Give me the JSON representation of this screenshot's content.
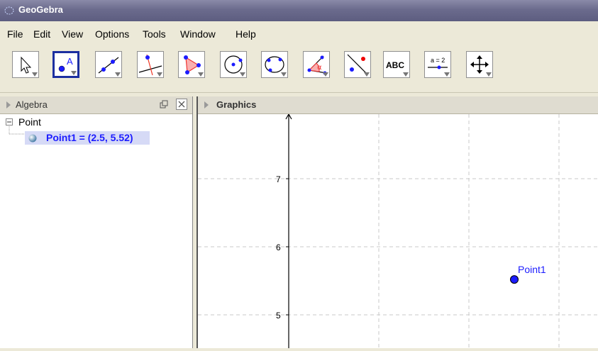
{
  "window": {
    "title": "GeoGebra"
  },
  "menu": [
    "File",
    "Edit",
    "View",
    "Options",
    "Tools",
    "Window",
    "Help"
  ],
  "toolbar": {
    "tools": [
      {
        "icon": "move-arrow-icon"
      },
      {
        "icon": "new-point-icon",
        "label": "A",
        "selected": true
      },
      {
        "icon": "line-through-two-points-icon"
      },
      {
        "icon": "perpendicular-line-icon"
      },
      {
        "icon": "polygon-icon"
      },
      {
        "icon": "circle-center-point-icon"
      },
      {
        "icon": "conic-through-five-points-icon"
      },
      {
        "icon": "angle-icon",
        "label": "α"
      },
      {
        "icon": "reflect-about-line-icon"
      },
      {
        "icon": "insert-text-icon",
        "label": "ABC"
      },
      {
        "icon": "slider-icon",
        "label": "a = 2"
      },
      {
        "icon": "move-graphics-view-icon"
      }
    ]
  },
  "algebra_view": {
    "title": "Algebra",
    "tree": {
      "group": "Point",
      "items": [
        "Point1 = (2.5, 5.52)"
      ]
    }
  },
  "graphics_view": {
    "title": "Graphics",
    "y_tick_labels": [
      "7",
      "6",
      "5"
    ],
    "point": {
      "name": "Point1",
      "x": 2.5,
      "y": 5.52,
      "color": "#1c1cff"
    }
  },
  "colors": {
    "accent": "#1c2fa0",
    "point": "#1c1cff",
    "title_bar": "#6b6b8d"
  }
}
